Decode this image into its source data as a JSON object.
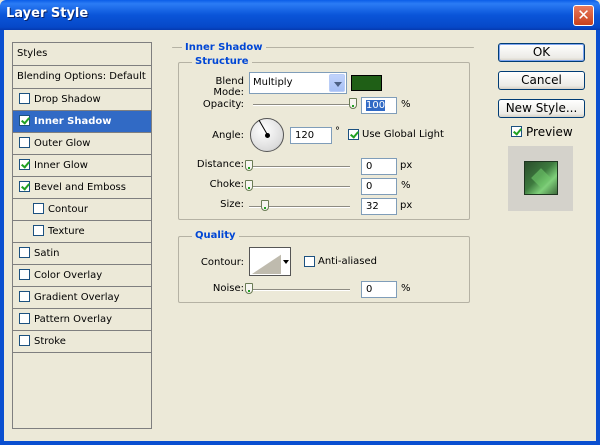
{
  "window": {
    "title": "Layer Style",
    "close_symbol": "✕"
  },
  "styles_list": {
    "header": "Styles",
    "blending_options": "Blending Options: Default",
    "items": [
      {
        "label": "Drop Shadow",
        "checked": false,
        "selected": false,
        "sub": false
      },
      {
        "label": "Inner Shadow",
        "checked": true,
        "selected": true,
        "sub": false
      },
      {
        "label": "Outer Glow",
        "checked": false,
        "selected": false,
        "sub": false
      },
      {
        "label": "Inner Glow",
        "checked": true,
        "selected": false,
        "sub": false
      },
      {
        "label": "Bevel and Emboss",
        "checked": true,
        "selected": false,
        "sub": false
      },
      {
        "label": "Contour",
        "checked": false,
        "selected": false,
        "sub": true
      },
      {
        "label": "Texture",
        "checked": false,
        "selected": false,
        "sub": true
      },
      {
        "label": "Satin",
        "checked": false,
        "selected": false,
        "sub": false
      },
      {
        "label": "Color Overlay",
        "checked": false,
        "selected": false,
        "sub": false
      },
      {
        "label": "Gradient Overlay",
        "checked": false,
        "selected": false,
        "sub": false
      },
      {
        "label": "Pattern Overlay",
        "checked": false,
        "selected": false,
        "sub": false
      },
      {
        "label": "Stroke",
        "checked": false,
        "selected": false,
        "sub": false
      }
    ]
  },
  "inner_shadow": {
    "section_title": "Inner Shadow",
    "structure": {
      "title": "Structure",
      "blend_mode_label": "Blend Mode:",
      "blend_mode_value": "Multiply",
      "shadow_color": "#1f5f16",
      "opacity_label": "Opacity:",
      "opacity_value": "100",
      "opacity_unit": "%",
      "opacity_fraction": 1.0,
      "angle_label": "Angle:",
      "angle_value": "120",
      "angle_unit": "°",
      "use_global_light_label": "Use Global Light",
      "use_global_light": true,
      "distance_label": "Distance:",
      "distance_value": "0",
      "distance_unit": "px",
      "distance_fraction": 0.0,
      "choke_label": "Choke:",
      "choke_value": "0",
      "choke_unit": "%",
      "choke_fraction": 0.0,
      "size_label": "Size:",
      "size_value": "32",
      "size_unit": "px",
      "size_fraction": 0.16
    },
    "quality": {
      "title": "Quality",
      "contour_label": "Contour:",
      "anti_aliased_label": "Anti-aliased",
      "anti_aliased": false,
      "noise_label": "Noise:",
      "noise_value": "0",
      "noise_unit": "%",
      "noise_fraction": 0.0
    }
  },
  "buttons": {
    "ok": "OK",
    "cancel": "Cancel",
    "new_style": "New Style...",
    "preview_label": "Preview",
    "preview_checked": true
  }
}
